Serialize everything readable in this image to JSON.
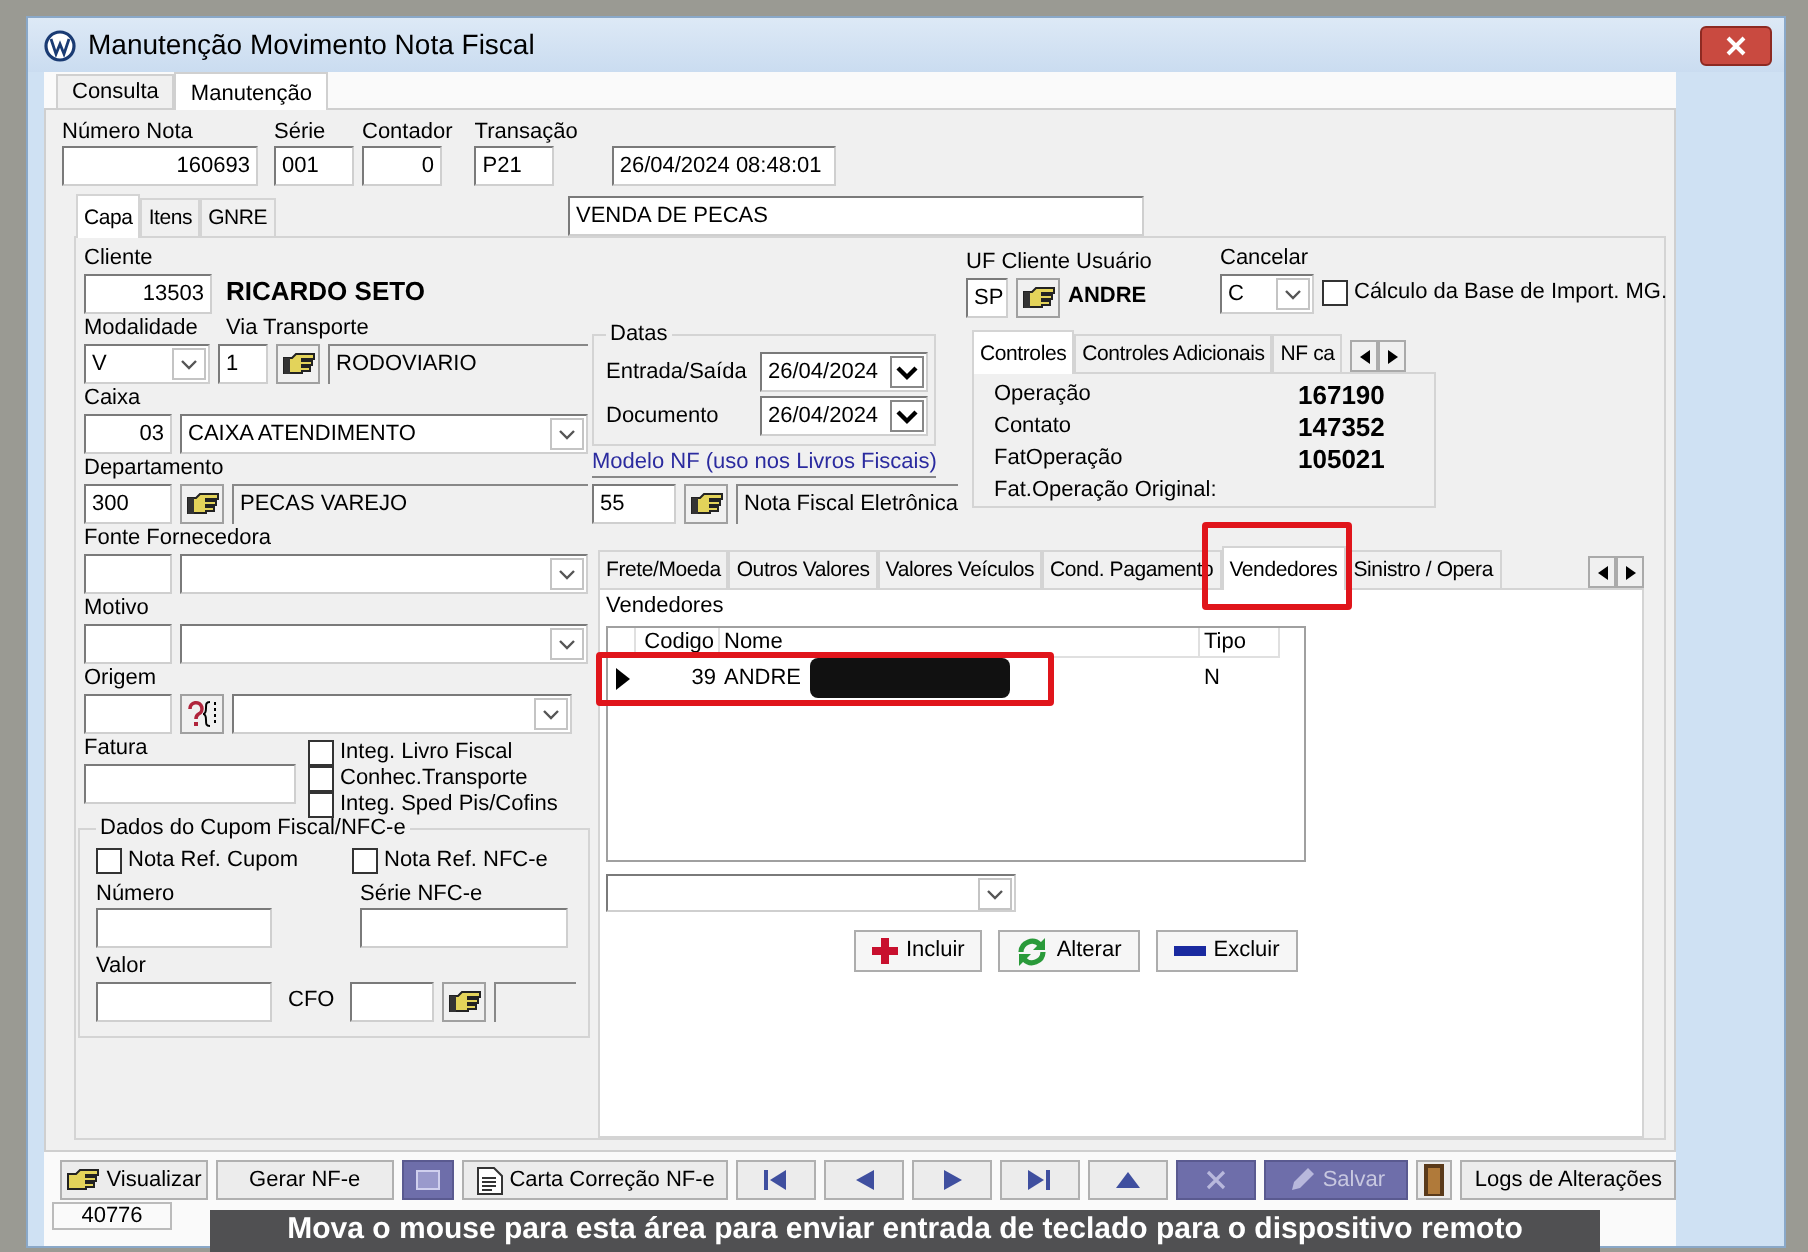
{
  "window": {
    "title": "Manutenção Movimento Nota Fiscal"
  },
  "main_tabs": [
    {
      "label": "Consulta",
      "selected": false
    },
    {
      "label": "Manutenção",
      "selected": true
    }
  ],
  "header_fields": [
    {
      "label": "Número Nota",
      "value": "160693",
      "kind": "numeric"
    },
    {
      "label": "Série",
      "value": "001",
      "kind": "text"
    },
    {
      "label": "Contador",
      "value": "0",
      "kind": "numeric"
    },
    {
      "label": "Transação",
      "value": "P21",
      "kind": "text"
    }
  ],
  "timestamp": "26/04/2024 08:48:01",
  "form_tabs": [
    {
      "label": "Capa",
      "selected": true
    },
    {
      "label": "Itens",
      "selected": false
    },
    {
      "label": "GNRE",
      "selected": false
    }
  ],
  "transaction_description": "VENDA DE PECAS",
  "cliente": {
    "label": "Cliente",
    "code": "13503",
    "name": "RICARDO SETO"
  },
  "modalidade": {
    "label": "Modalidade",
    "value": "V"
  },
  "via_transporte": {
    "label": "Via Transporte",
    "code": "1",
    "description": "RODOVIARIO"
  },
  "caixa": {
    "label": "Caixa",
    "code": "03",
    "description": "CAIXA ATENDIMENTO"
  },
  "departamento": {
    "label": "Departamento",
    "code": "300",
    "description": "PECAS VAREJO"
  },
  "fonte_fornecedora": {
    "label": "Fonte Fornecedora"
  },
  "motivo": {
    "label": "Motivo"
  },
  "origem": {
    "label": "Origem"
  },
  "fatura": {
    "label": "Fatura"
  },
  "fatura_options": [
    {
      "label": "Integ. Livro Fiscal",
      "checked": false
    },
    {
      "label": "Conhec.Transporte",
      "checked": false
    },
    {
      "label": "Integ. Sped Pis/Cofins",
      "checked": false
    }
  ],
  "cupom_group": {
    "title": "Dados do Cupom Fiscal/NFC-e",
    "options": [
      {
        "label": "Nota Ref. Cupom",
        "checked": false
      },
      {
        "label": "Nota Ref. NFC-e",
        "checked": false
      }
    ],
    "numero_label": "Número",
    "serie_label": "Série NFC-e",
    "valor_label": "Valor",
    "cfo_label": "CFO"
  },
  "uf_cliente": {
    "label": "UF Cliente Usuário",
    "uf": "SP",
    "user": "ANDRE"
  },
  "cancelar": {
    "label": "Cancelar",
    "value": "C"
  },
  "calculo_base": {
    "label": "Cálculo da Base de Import. MG.",
    "checked": false
  },
  "datas": {
    "title": "Datas",
    "entrada_label": "Entrada/Saída",
    "entrada": "26/04/2024",
    "documento_label": "Documento",
    "documento": "26/04/2024"
  },
  "modelo_nf": {
    "label": "Modelo NF (uso nos Livros Fiscais)",
    "code": "55",
    "description": "Nota Fiscal Eletrônica"
  },
  "control_tabs": [
    {
      "label": "Controles",
      "selected": true
    },
    {
      "label": "Controles Adicionais",
      "selected": false
    },
    {
      "label": "NF ca",
      "selected": false
    }
  ],
  "control_values": [
    {
      "label": "Operação",
      "value": "167190"
    },
    {
      "label": "Contato",
      "value": "147352"
    },
    {
      "label": "FatOperação",
      "value": "105021"
    },
    {
      "label": "Fat.Operação Original:"
    }
  ],
  "detail_tabs": [
    {
      "label": "Frete/Moeda",
      "selected": false
    },
    {
      "label": "Outros Valores",
      "selected": false
    },
    {
      "label": "Valores Veículos",
      "selected": false
    },
    {
      "label": "Cond. Pagamento",
      "selected": false
    },
    {
      "label": "Vendedores",
      "selected": true
    },
    {
      "label": "Sinistro / Opera",
      "selected": false
    }
  ],
  "vendedores": {
    "title": "Vendedores",
    "columns": [
      "Codigo",
      "Nome",
      "Tipo"
    ],
    "rows": [
      {
        "codigo": "39",
        "nome": "ANDRE",
        "tipo": "N",
        "selected": true
      }
    ]
  },
  "vendor_actions": [
    {
      "label": "Incluir",
      "kind": "add"
    },
    {
      "label": "Alterar",
      "kind": "edit"
    },
    {
      "label": "Excluir",
      "kind": "delete"
    }
  ],
  "toolbar": [
    {
      "label": "Visualizar",
      "kind": "view",
      "disabled": false
    },
    {
      "label": "Gerar NF-e",
      "kind": "plain",
      "disabled": false
    },
    {
      "kind": "window",
      "disabled": true
    },
    {
      "label": "Carta Correção NF-e",
      "kind": "letter",
      "disabled": false
    },
    {
      "kind": "first",
      "disabled": false
    },
    {
      "kind": "prev",
      "disabled": false
    },
    {
      "kind": "next",
      "disabled": false
    },
    {
      "kind": "last",
      "disabled": false
    },
    {
      "kind": "up",
      "disabled": false
    },
    {
      "kind": "cancel",
      "disabled": true
    },
    {
      "label": "Salvar",
      "kind": "save",
      "disabled": true
    },
    {
      "kind": "exit",
      "disabled": false
    },
    {
      "label": "Logs de Alterações",
      "kind": "plain",
      "disabled": false
    }
  ],
  "status_bar": {
    "record": "40776"
  },
  "remote_hint": "Mova o mouse para esta área para enviar entrada de teclado para o dispositivo remoto"
}
